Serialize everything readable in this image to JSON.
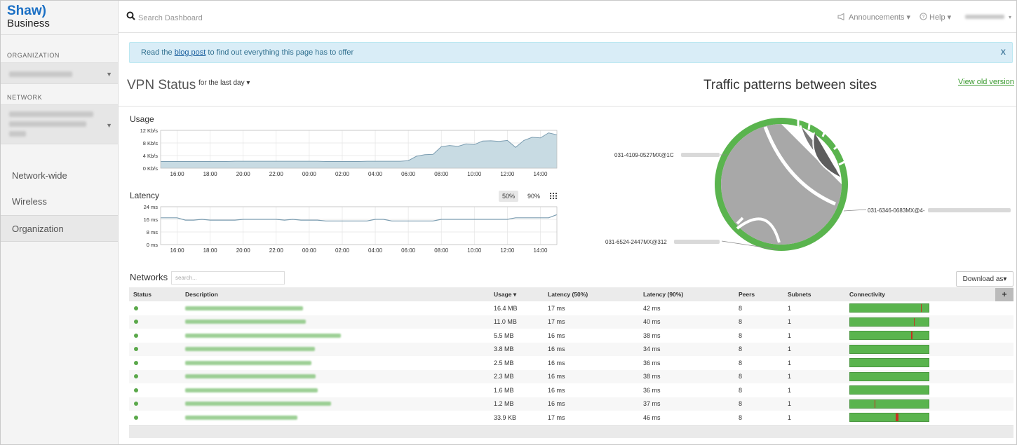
{
  "brand": {
    "line1": "Shaw)",
    "line2": "Business"
  },
  "sidebar": {
    "org_label": "ORGANIZATION",
    "network_label": "NETWORK",
    "nav": [
      "Network-wide",
      "Wireless",
      "Organization"
    ]
  },
  "topbar": {
    "search_placeholder": "Search Dashboard",
    "announcements": "Announcements ▾",
    "help": "Help ▾"
  },
  "banner": {
    "prefix": "Read the ",
    "link": "blog post",
    "suffix": " to find out everything this page has to offer",
    "close": "X"
  },
  "vpn": {
    "title": "VPN Status",
    "timeframe": "for the last day ▾"
  },
  "traffic": {
    "title": "Traffic patterns between sites",
    "view_old": "View old version",
    "labels": [
      "031-4109-0527MX@1C",
      "031-6346-0683MX@4-",
      "031-6524-2447MX@312"
    ]
  },
  "usage_chart": {
    "label": "Usage",
    "y_ticks": [
      "12 Kb/s",
      "8 Kb/s",
      "4 Kb/s",
      "0 Kb/s"
    ],
    "x_ticks": [
      "16:00",
      "18:00",
      "20:00",
      "22:00",
      "00:00",
      "02:00",
      "04:00",
      "06:00",
      "08:00",
      "10:00",
      "12:00",
      "14:00"
    ]
  },
  "latency_chart": {
    "label": "Latency",
    "y_ticks": [
      "24 ms",
      "16 ms",
      "8 ms",
      "0 ms"
    ],
    "x_ticks": [
      "16:00",
      "18:00",
      "20:00",
      "22:00",
      "00:00",
      "02:00",
      "04:00",
      "06:00",
      "08:00",
      "10:00",
      "12:00",
      "14:00"
    ],
    "percentiles": [
      "50%",
      "90%"
    ]
  },
  "chart_data": [
    {
      "type": "area",
      "title": "Usage",
      "x": [
        "15:00",
        "15:30",
        "16:00",
        "16:30",
        "17:00",
        "17:30",
        "18:00",
        "18:30",
        "19:00",
        "19:30",
        "20:00",
        "20:30",
        "21:00",
        "21:30",
        "22:00",
        "22:30",
        "23:00",
        "23:30",
        "00:00",
        "00:30",
        "01:00",
        "01:30",
        "02:00",
        "02:30",
        "03:00",
        "03:30",
        "04:00",
        "04:30",
        "05:00",
        "05:30",
        "06:00",
        "06:30",
        "07:00",
        "07:30",
        "08:00",
        "08:30",
        "09:00",
        "09:30",
        "10:00",
        "10:30",
        "11:00",
        "11:30",
        "12:00",
        "12:30",
        "13:00",
        "13:30",
        "14:00",
        "14:30",
        "15:00"
      ],
      "values": [
        2.1,
        2.1,
        2.1,
        2.1,
        2.1,
        2.1,
        2.1,
        2.1,
        2.1,
        2.2,
        2.2,
        2.2,
        2.2,
        2.2,
        2.2,
        2.2,
        2.2,
        2.2,
        2.2,
        2.2,
        2.1,
        2.1,
        2.1,
        2.1,
        2.1,
        2.2,
        2.2,
        2.2,
        2.2,
        2.2,
        2.4,
        3.8,
        4.3,
        4.4,
        6.8,
        7.2,
        6.9,
        7.7,
        7.5,
        8.6,
        8.7,
        8.5,
        8.8,
        6.6,
        8.8,
        9.8,
        9.6,
        11.2,
        10.6
      ],
      "ylim": [
        0,
        12
      ],
      "ylabel": "Kb/s"
    },
    {
      "type": "line",
      "title": "Latency",
      "x": [
        "15:00",
        "15:30",
        "16:00",
        "16:30",
        "17:00",
        "17:30",
        "18:00",
        "18:30",
        "19:00",
        "19:30",
        "20:00",
        "20:30",
        "21:00",
        "21:30",
        "22:00",
        "22:30",
        "23:00",
        "23:30",
        "00:00",
        "00:30",
        "01:00",
        "01:30",
        "02:00",
        "02:30",
        "03:00",
        "03:30",
        "04:00",
        "04:30",
        "05:00",
        "05:30",
        "06:00",
        "06:30",
        "07:00",
        "07:30",
        "08:00",
        "08:30",
        "09:00",
        "09:30",
        "10:00",
        "10:30",
        "11:00",
        "11:30",
        "12:00",
        "12:30",
        "13:00",
        "13:30",
        "14:00",
        "14:30",
        "15:00"
      ],
      "values": [
        17,
        17,
        17,
        15.5,
        15.5,
        16,
        15.5,
        15.5,
        15.5,
        15.5,
        16,
        16,
        16,
        16,
        16,
        15.5,
        16,
        15.5,
        15.5,
        15.5,
        15,
        15,
        15,
        15,
        15,
        15,
        16,
        16,
        15,
        15,
        15,
        15,
        15,
        15,
        16,
        16,
        16,
        16,
        16,
        16,
        16,
        16,
        16,
        17,
        17,
        17,
        17,
        17,
        19
      ],
      "ylim": [
        0,
        24
      ],
      "ylabel": "ms"
    }
  ],
  "networks": {
    "title": "Networks",
    "search_placeholder": "search...",
    "download": "Download as▾",
    "columns": [
      "Status",
      "Description",
      "Usage ▾",
      "Latency (50%)",
      "Latency (90%)",
      "Peers",
      "Subnets",
      "Connectivity",
      "+"
    ],
    "rows": [
      {
        "usage": "16.4 MB",
        "lat50": "17 ms",
        "lat90": "42 ms",
        "peers": "8",
        "subnets": "1",
        "ticks": [
          0.9
        ]
      },
      {
        "usage": "11.0 MB",
        "lat50": "17 ms",
        "lat90": "40 ms",
        "peers": "8",
        "subnets": "1",
        "ticks": [
          0.81
        ]
      },
      {
        "usage": "5.5 MB",
        "lat50": "16 ms",
        "lat90": "38 ms",
        "peers": "8",
        "subnets": "1",
        "ticks": [
          0.78
        ]
      },
      {
        "usage": "3.8 MB",
        "lat50": "16 ms",
        "lat90": "34 ms",
        "peers": "8",
        "subnets": "1",
        "ticks": []
      },
      {
        "usage": "2.5 MB",
        "lat50": "16 ms",
        "lat90": "36 ms",
        "peers": "8",
        "subnets": "1",
        "ticks": []
      },
      {
        "usage": "2.3 MB",
        "lat50": "16 ms",
        "lat90": "38 ms",
        "peers": "8",
        "subnets": "1",
        "ticks": []
      },
      {
        "usage": "1.6 MB",
        "lat50": "16 ms",
        "lat90": "36 ms",
        "peers": "8",
        "subnets": "1",
        "ticks": []
      },
      {
        "usage": "1.2 MB",
        "lat50": "16 ms",
        "lat90": "37 ms",
        "peers": "8",
        "subnets": "1",
        "ticks": [
          0.31
        ]
      },
      {
        "usage": "33.9 KB",
        "lat50": "17 ms",
        "lat90": "46 ms",
        "peers": "8",
        "subnets": "1",
        "ticks": [
          0.58,
          0.6
        ]
      }
    ]
  },
  "colors": {
    "brand": "#1a6fc4",
    "accent_green": "#5ab44e",
    "link_green": "#3a9a2f",
    "chart_fill": "#c8dbe3",
    "chart_line": "#7a9cb0"
  }
}
